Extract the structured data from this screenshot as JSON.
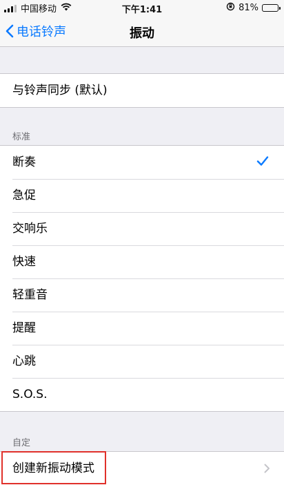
{
  "status_bar": {
    "carrier": "中国移动",
    "time": "下午1:41",
    "battery_percent": "81%",
    "battery_level": 0.81
  },
  "nav": {
    "back_label": "电话铃声",
    "title": "振动"
  },
  "sync_row": {
    "label": "与铃声同步 (默认)"
  },
  "standard": {
    "header": "标准",
    "items": [
      {
        "label": "断奏",
        "selected": true
      },
      {
        "label": "急促"
      },
      {
        "label": "交响乐"
      },
      {
        "label": "快速"
      },
      {
        "label": "轻重音"
      },
      {
        "label": "提醒"
      },
      {
        "label": "心跳"
      },
      {
        "label": "S.O.S."
      }
    ]
  },
  "custom": {
    "header": "自定",
    "create_label": "创建新振动模式"
  },
  "colors": {
    "accent": "#0a7aff",
    "highlight": "#e0302a",
    "background": "#efeff4"
  }
}
